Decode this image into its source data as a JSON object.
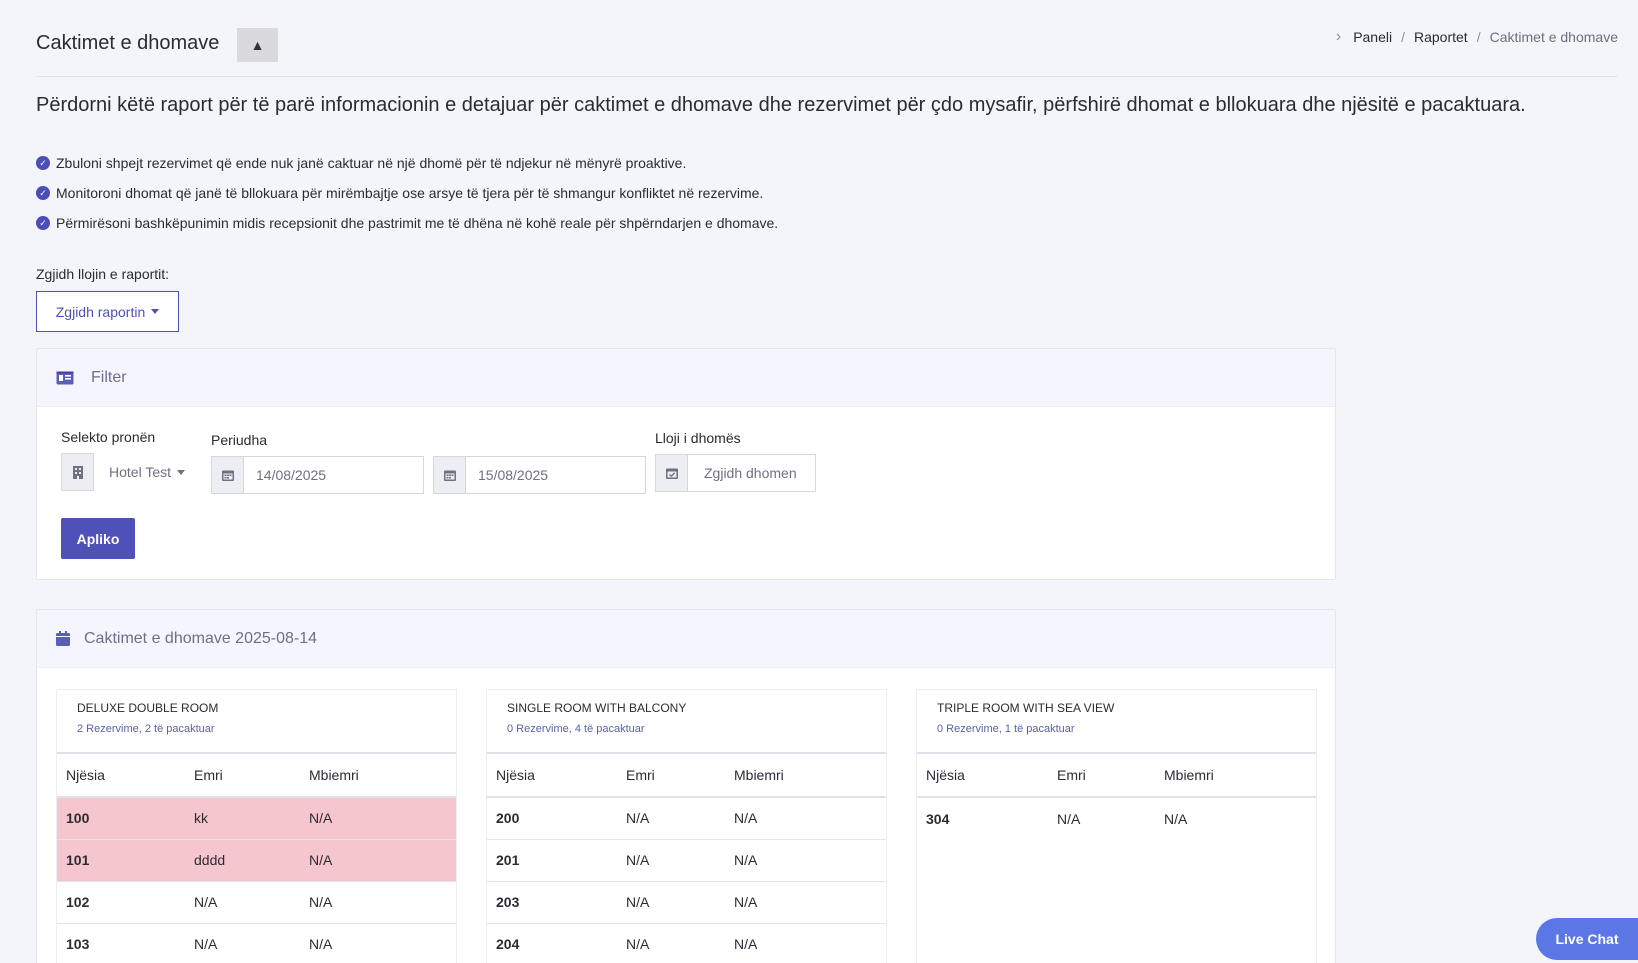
{
  "header": {
    "title": "Caktimet e dhomave",
    "collapse_label": "▲",
    "breadcrumb": [
      "Paneli",
      "Raportet",
      "Caktimet e dhomave"
    ]
  },
  "intro": "Përdorni këtë raport për të parë informacionin e detajuar për caktimet e dhomave dhe rezervimet për çdo mysafir, përfshirë dhomat e bllokuara dhe njësitë e pacaktuara.",
  "bullets": [
    "Zbuloni shpejt rezervimet që ende nuk janë caktuar në një dhomë për të ndjekur në mënyrë proaktive.",
    "Monitoroni dhomat që janë të bllokuara për mirëmbajtje ose arsye të tjera për të shmangur konfliktet në rezervime.",
    "Përmirësoni bashkëpunimin midis recepsionit dhe pastrimit me të dhëna në kohë reale për shpërndarjen e dhomave."
  ],
  "report": {
    "label": "Zgjidh llojin e raportit:",
    "dropdown": "Zgjidh raportin"
  },
  "filter": {
    "title": "Filter",
    "property_label": "Selekto pronën",
    "property_value": "Hotel Test",
    "period_label": "Periudha",
    "date_from": "14/08/2025",
    "date_to": "15/08/2025",
    "room_type_label": "Lloji i dhomës",
    "room_type_placeholder": "Zgjidh dhomen",
    "apply": "Apliko"
  },
  "assignments": {
    "title": "Caktimet e dhomave 2025-08-14",
    "columns": [
      "Njësia",
      "Emri",
      "Mbiemri"
    ],
    "rooms": [
      {
        "name": "DELUXE DOUBLE ROOM",
        "summary": "2 Rezervime, 2 të pacaktuar",
        "rows": [
          {
            "unit": "100",
            "name": "kk",
            "surname": "N/A",
            "blocked": true
          },
          {
            "unit": "101",
            "name": "dddd",
            "surname": "N/A",
            "blocked": true
          },
          {
            "unit": "102",
            "name": "N/A",
            "surname": "N/A",
            "blocked": false
          },
          {
            "unit": "103",
            "name": "N/A",
            "surname": "N/A",
            "blocked": false
          }
        ]
      },
      {
        "name": "SINGLE ROOM WITH BALCONY",
        "summary": "0 Rezervime, 4 të pacaktuar",
        "rows": [
          {
            "unit": "200",
            "name": "N/A",
            "surname": "N/A",
            "blocked": false
          },
          {
            "unit": "201",
            "name": "N/A",
            "surname": "N/A",
            "blocked": false
          },
          {
            "unit": "203",
            "name": "N/A",
            "surname": "N/A",
            "blocked": false
          },
          {
            "unit": "204",
            "name": "N/A",
            "surname": "N/A",
            "blocked": false
          }
        ]
      },
      {
        "name": "TRIPLE ROOM WITH SEA VIEW",
        "summary": "0 Rezervime, 1 të pacaktuar",
        "rows": [
          {
            "unit": "304",
            "name": "N/A",
            "surname": "N/A",
            "blocked": false
          }
        ]
      }
    ]
  },
  "live_chat": "Live Chat",
  "colors": {
    "accent": "#4f51b8",
    "blocked_row": "#f5c6cd",
    "live_chat": "#5b77e6"
  },
  "icons": {
    "breadcrumb": "chevron-right-icon",
    "bullet": "check-circle-icon",
    "filter": "id-card-icon",
    "property": "building-icon",
    "date": "calendar-icon",
    "room_type": "calendar-check-icon",
    "assignments": "calendar-icon"
  }
}
